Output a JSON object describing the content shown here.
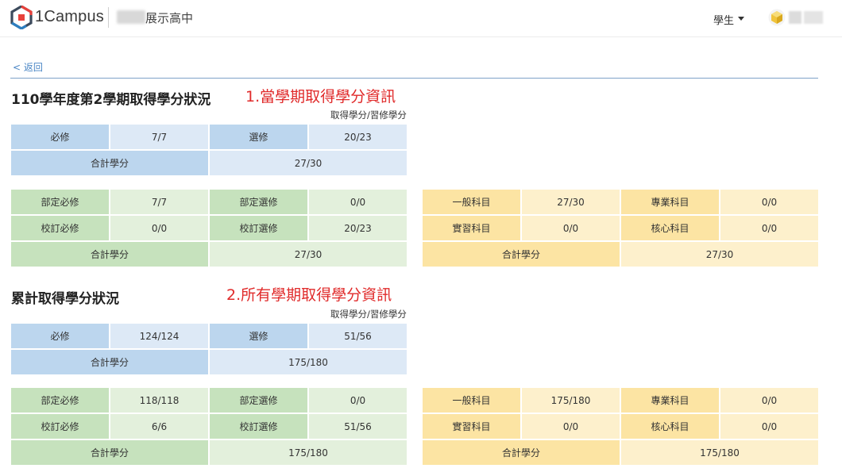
{
  "header": {
    "brand": "1Campus",
    "school_name": "展示高中",
    "role_label": "學生",
    "icons": {
      "logo": "1campus-logo-icon",
      "caret": "caret-down-icon",
      "avatar": "user-avatar-icon"
    },
    "accent_colors": {
      "logo_red": "#e8413b",
      "logo_blue": "#2d7fc1",
      "logo_dark": "#3c4a5c"
    }
  },
  "nav": {
    "back_label": "< 返回"
  },
  "legend_text": "取得學分/習修學分",
  "sections": [
    {
      "title": "110學年度第2學期取得學分狀況",
      "annotation": "1.當學期取得學分資訊",
      "legend": "取得學分/習修學分",
      "summary": {
        "required_label": "必修",
        "required_value": "7/7",
        "elective_label": "選修",
        "elective_value": "20/23",
        "total_label": "合計學分",
        "total_value": "27/30"
      },
      "green": {
        "r1c1_label": "部定必修",
        "r1c1_value": "7/7",
        "r1c2_label": "部定選修",
        "r1c2_value": "0/0",
        "r2c1_label": "校訂必修",
        "r2c1_value": "0/0",
        "r2c2_label": "校訂選修",
        "r2c2_value": "20/23",
        "total_label": "合計學分",
        "total_value": "27/30"
      },
      "yellow": {
        "r1c1_label": "一般科目",
        "r1c1_value": "27/30",
        "r1c2_label": "專業科目",
        "r1c2_value": "0/0",
        "r2c1_label": "實習科目",
        "r2c1_value": "0/0",
        "r2c2_label": "核心科目",
        "r2c2_value": "0/0",
        "total_label": "合計學分",
        "total_value": "27/30"
      }
    },
    {
      "title": "累計取得學分狀況",
      "annotation": "2.所有學期取得學分資訊",
      "legend": "取得學分/習修學分",
      "summary": {
        "required_label": "必修",
        "required_value": "124/124",
        "elective_label": "選修",
        "elective_value": "51/56",
        "total_label": "合計學分",
        "total_value": "175/180"
      },
      "green": {
        "r1c1_label": "部定必修",
        "r1c1_value": "118/118",
        "r1c2_label": "部定選修",
        "r1c2_value": "0/0",
        "r2c1_label": "校訂必修",
        "r2c1_value": "6/6",
        "r2c2_label": "校訂選修",
        "r2c2_value": "51/56",
        "total_label": "合計學分",
        "total_value": "175/180"
      },
      "yellow": {
        "r1c1_label": "一般科目",
        "r1c1_value": "175/180",
        "r1c2_label": "專業科目",
        "r1c2_value": "0/0",
        "r2c1_label": "實習科目",
        "r2c1_value": "0/0",
        "r2c2_label": "核心科目",
        "r2c2_value": "0/0",
        "total_label": "合計學分",
        "total_value": "175/180"
      }
    }
  ]
}
